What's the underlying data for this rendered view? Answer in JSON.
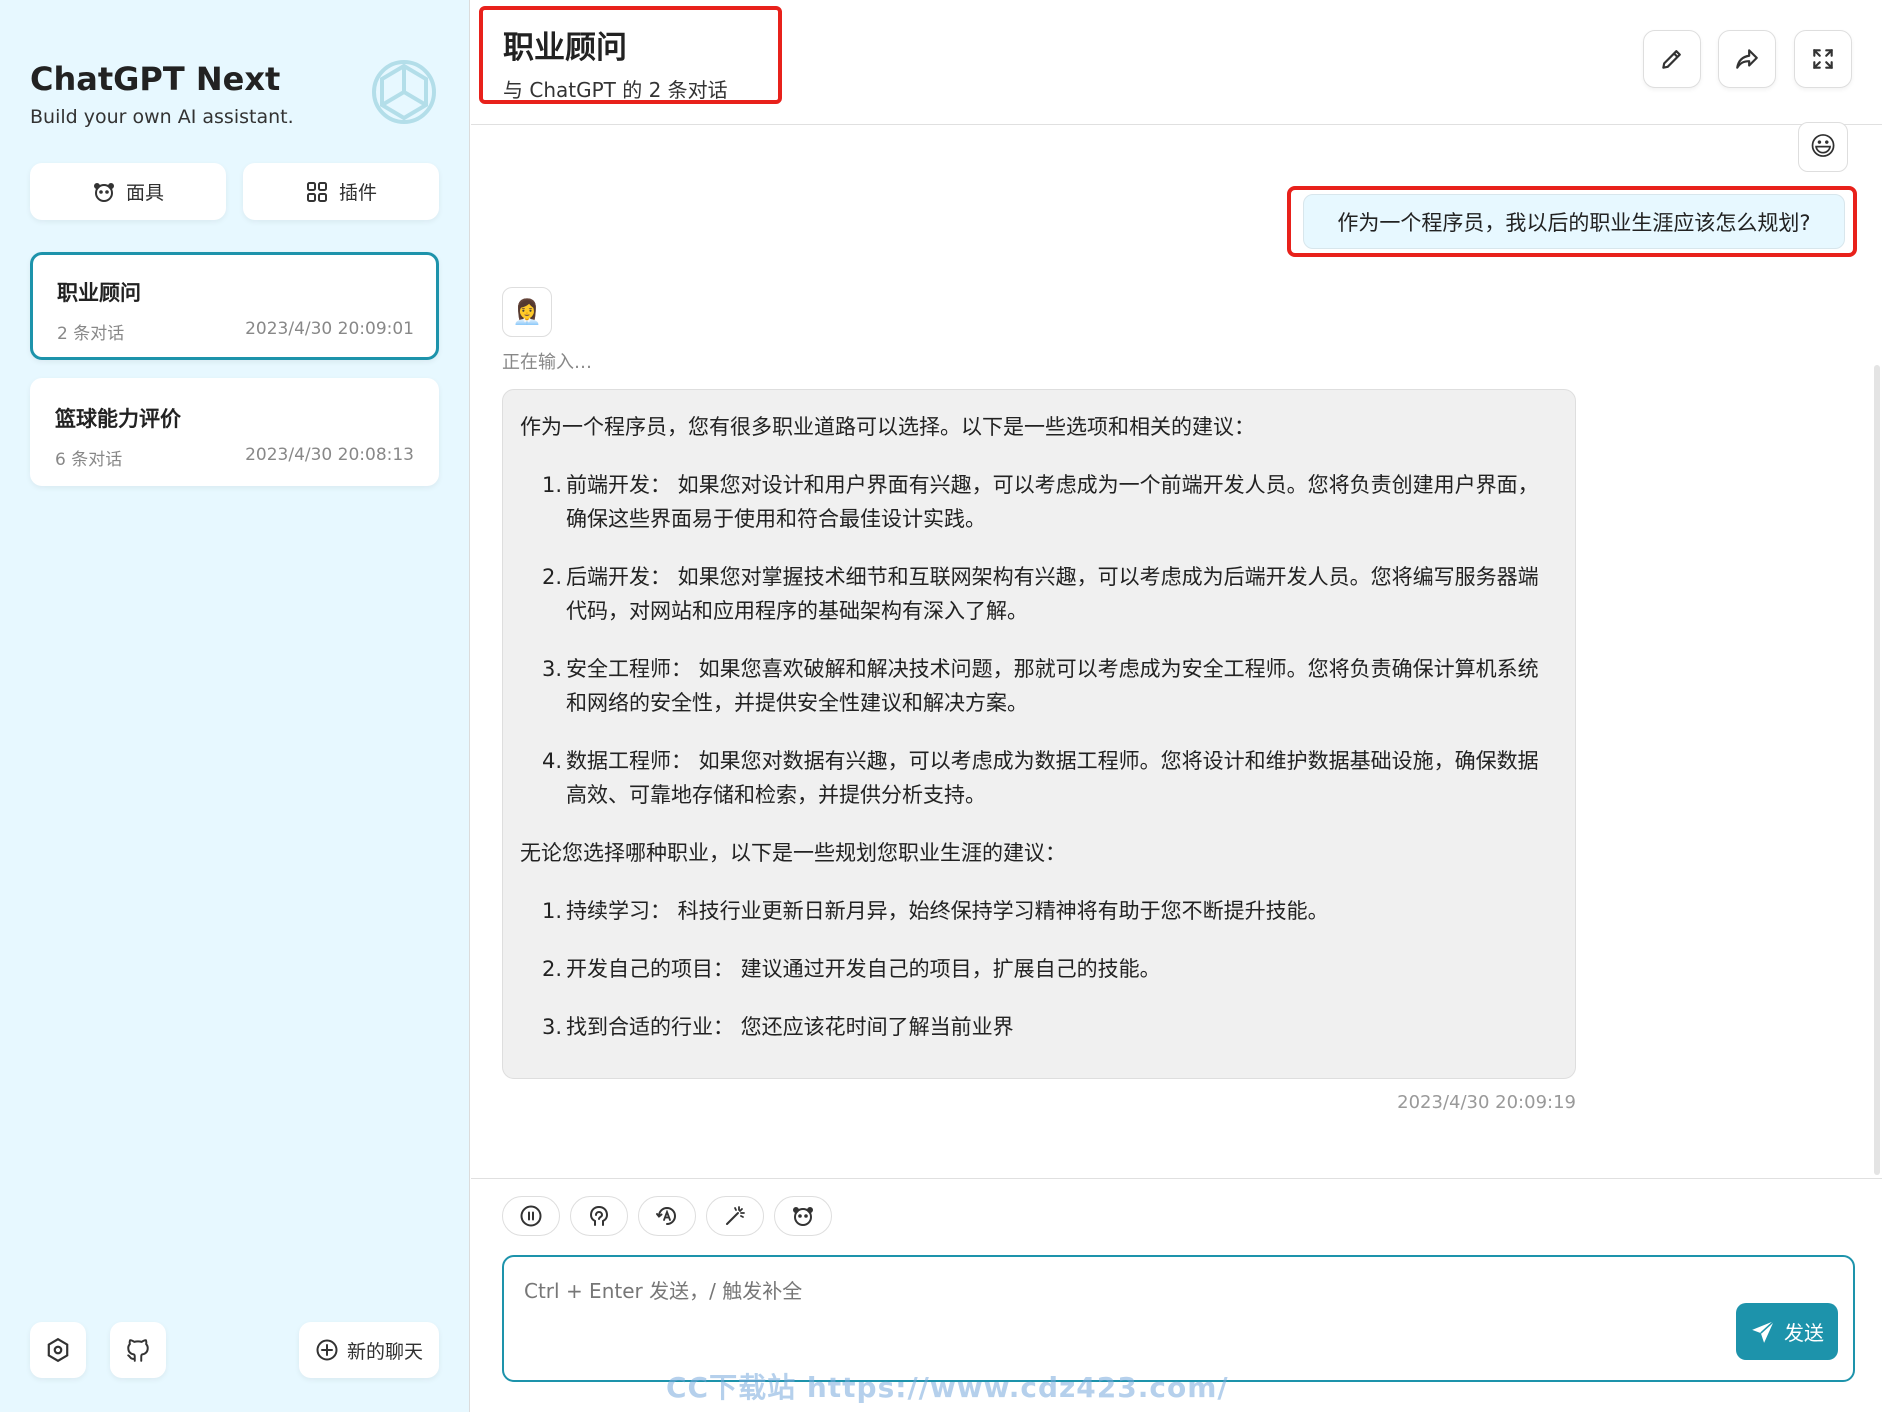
{
  "sidebar": {
    "title": "ChatGPT Next",
    "subtitle": "Build your own AI assistant.",
    "logo_icon": "openai-logo-icon",
    "mask_button": "面具",
    "plugin_button": "插件",
    "chats": [
      {
        "title": "职业顾问",
        "count": "2 条对话",
        "date": "2023/4/30 20:09:01"
      },
      {
        "title": "篮球能力评价",
        "count": "6 条对话",
        "date": "2023/4/30 20:08:13"
      }
    ],
    "new_chat_label": "新的聊天"
  },
  "header": {
    "title": "职业顾问",
    "subtitle": "与 ChatGPT 的 2 条对话"
  },
  "messages": {
    "user_avatar": "😃",
    "user_text": "作为一个程序员，我以后的职业生涯应该怎么规划?",
    "bot_avatar": "👩‍💼",
    "typing": "正在输入…",
    "bot_intro": "作为一个程序员，您有很多职业道路可以选择。以下是一些选项和相关的建议：",
    "bot_list1": [
      {
        "num": "1.",
        "text": "前端开发： 如果您对设计和用户界面有兴趣，可以考虑成为一个前端开发人员。您将负责创建用户界面，确保这些界面易于使用和符合最佳设计实践。"
      },
      {
        "num": "2.",
        "text": "后端开发： 如果您对掌握技术细节和互联网架构有兴趣，可以考虑成为后端开发人员。您将编写服务器端代码，对网站和应用程序的基础架构有深入了解。"
      },
      {
        "num": "3.",
        "text": "安全工程师： 如果您喜欢破解和解决技术问题，那就可以考虑成为安全工程师。您将负责确保计算机系统和网络的安全性，并提供安全性建议和解决方案。"
      },
      {
        "num": "4.",
        "text": "数据工程师： 如果您对数据有兴趣，可以考虑成为数据工程师。您将设计和维护数据基础设施，确保数据高效、可靠地存储和检索，并提供分析支持。"
      }
    ],
    "bot_mid": "无论您选择哪种职业，以下是一些规划您职业生涯的建议：",
    "bot_list2": [
      {
        "num": "1.",
        "text": "持续学习： 科技行业更新日新月异，始终保持学习精神将有助于您不断提升技能。"
      },
      {
        "num": "2.",
        "text": "开发自己的项目： 建议通过开发自己的项目，扩展自己的技能。"
      },
      {
        "num": "3.",
        "text": "找到合适的行业： 您还应该花时间了解当前业界"
      }
    ],
    "bot_time": "2023/4/30 20:09:19"
  },
  "input": {
    "placeholder": "Ctrl + Enter 发送，/ 触发补全",
    "send_label": "发送"
  },
  "watermark": "CC下载站 https://www.cdz423.com/",
  "colors": {
    "accent": "#1d93ab",
    "highlight": "#e8211b",
    "sidebar_bg": "#e7f8ff"
  }
}
